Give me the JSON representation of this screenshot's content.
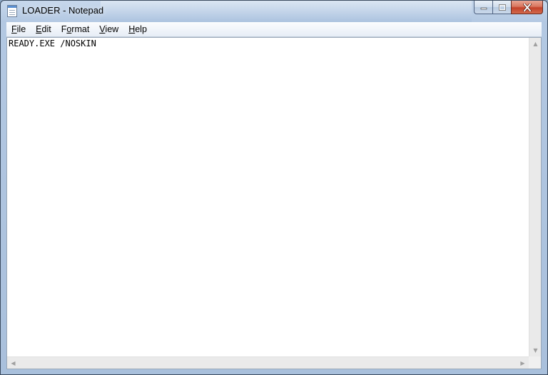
{
  "window": {
    "title": "LOADER - Notepad"
  },
  "menu": {
    "items": [
      {
        "first": "F",
        "rest": "ile"
      },
      {
        "first": "E",
        "rest": "dit"
      },
      {
        "first": "F",
        "rest": "ormat",
        "underline_index": 1
      },
      {
        "first": "V",
        "rest": "iew"
      },
      {
        "first": "H",
        "rest": "elp"
      }
    ]
  },
  "document": {
    "text": "READY.EXE /NOSKIN"
  },
  "icons": {
    "app": "notepad-icon",
    "minimize": "minimize-icon",
    "maximize": "maximize-icon",
    "close": "close-icon"
  }
}
